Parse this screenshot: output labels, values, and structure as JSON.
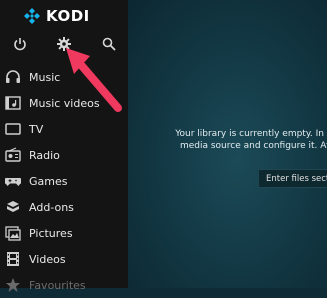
{
  "app": {
    "logo_text": "KODI"
  },
  "topbar": {
    "icons": [
      "power-icon",
      "settings-gear-icon",
      "search-icon"
    ]
  },
  "sidebar": {
    "items": [
      {
        "label": "Music",
        "icon": "headphones-icon"
      },
      {
        "label": "Music videos",
        "icon": "music-video-icon"
      },
      {
        "label": "TV",
        "icon": "tv-icon"
      },
      {
        "label": "Radio",
        "icon": "radio-icon"
      },
      {
        "label": "Games",
        "icon": "gamepad-icon"
      },
      {
        "label": "Add-ons",
        "icon": "addons-box-icon"
      },
      {
        "label": "Pictures",
        "icon": "pictures-icon"
      },
      {
        "label": "Videos",
        "icon": "film-icon"
      },
      {
        "label": "Favourites",
        "icon": "star-icon"
      }
    ]
  },
  "main": {
    "empty_message_line1": "Your library is currently empty. In order to po",
    "empty_message_line2": "media source and configure it. After the sc",
    "enter_button_label": "Enter files section"
  },
  "annotation": {
    "arrow_color": "#f0395e"
  }
}
